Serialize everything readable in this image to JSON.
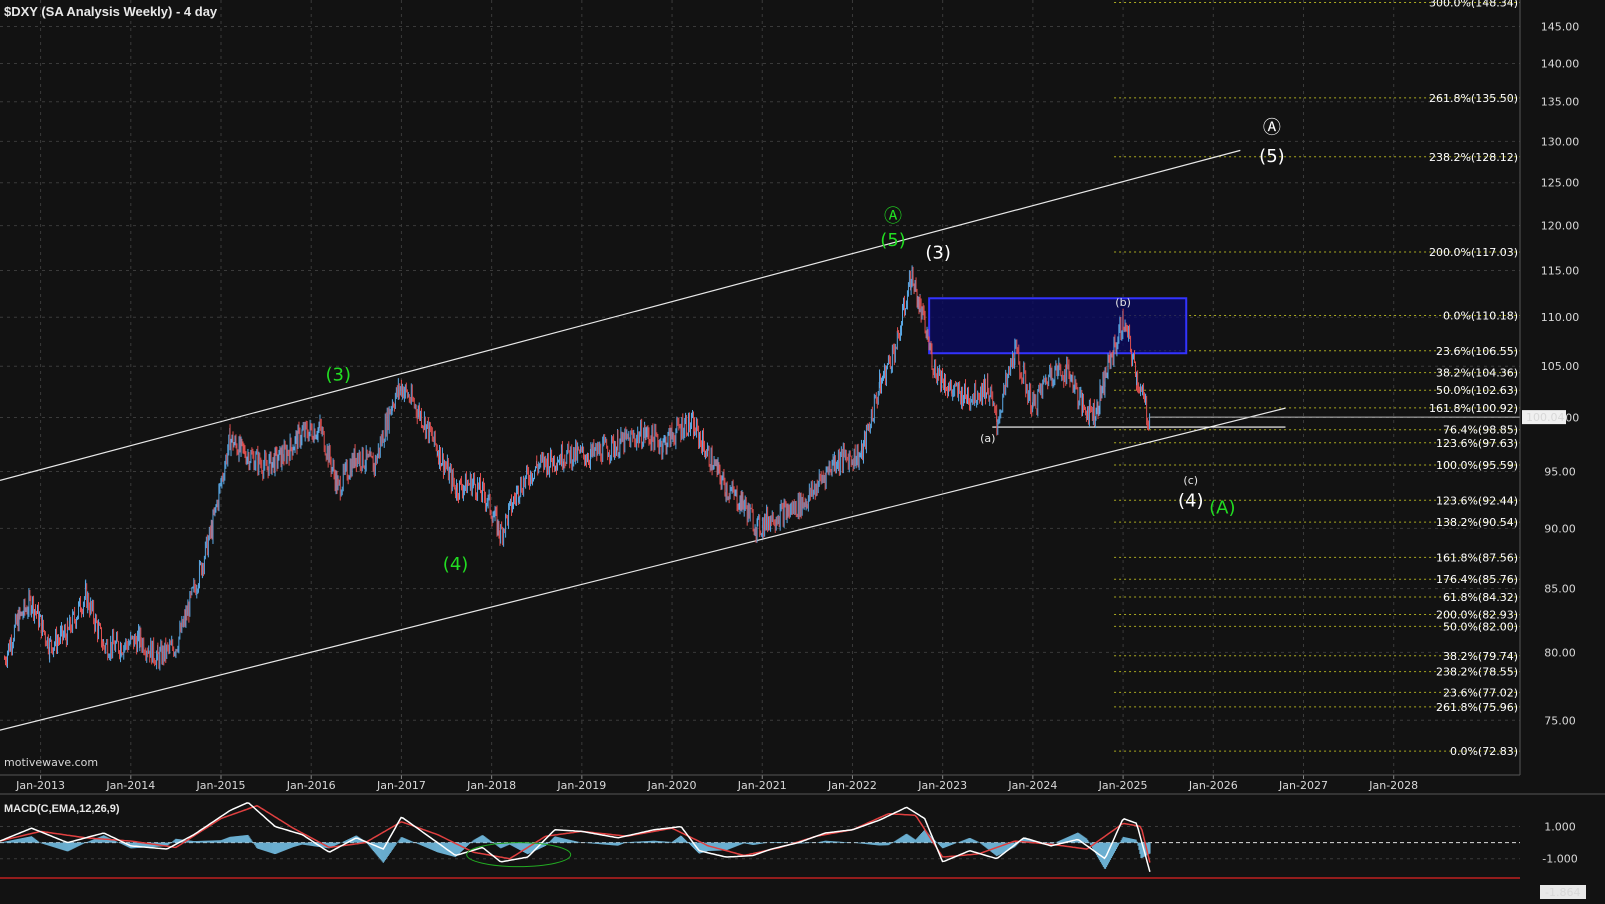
{
  "title": "$DXY (SA Analysis Weekly) - 4 day",
  "watermark": "motivewave.com",
  "colors": {
    "background": "#121212",
    "up_candle": "#5aa9e6",
    "down_candle": "#e05050",
    "fib_line": "#a8a820",
    "grid": "#3a3a3a",
    "green_label": "#22dd22",
    "white_label": "#ffffff",
    "box_fill": "#0a0a60",
    "box_stroke": "#3333ff",
    "macd_line": "#ffffff",
    "signal_line": "#e04040",
    "histogram": "#6aaed0"
  },
  "chart_data": [
    {
      "type": "line",
      "subtype": "candlestick",
      "title": "$DXY (SA Analysis Weekly) - 4 day",
      "x_ticks": [
        "Jan-2013",
        "Jan-2014",
        "Jan-2015",
        "Jan-2016",
        "Jan-2017",
        "Jan-2018",
        "Jan-2019",
        "Jan-2020",
        "Jan-2021",
        "Jan-2022",
        "Jan-2023",
        "Jan-2024",
        "Jan-2025",
        "Jan-2026",
        "Jan-2027",
        "Jan-2028"
      ],
      "x_tick_values": [
        2013,
        2014,
        2015,
        2016,
        2017,
        2018,
        2019,
        2020,
        2021,
        2022,
        2023,
        2024,
        2025,
        2026,
        2027,
        2028
      ],
      "xlim": [
        2012.55,
        2029.4
      ],
      "y_ticks": [
        "145.00",
        "140.00",
        "135.00",
        "130.00",
        "125.00",
        "120.00",
        "115.00",
        "110.00",
        "105.00",
        "100.00",
        "95.00",
        "90.00",
        "85.00",
        "80.00",
        "75.00"
      ],
      "y_tick_values": [
        145,
        140,
        135,
        130,
        125,
        120,
        115,
        110,
        105,
        100,
        95,
        90,
        85,
        80,
        75
      ],
      "ylim": [
        71.2,
        148.7
      ],
      "y_scale": "log",
      "grid": true,
      "last_price_label": "100.04",
      "last_price": 100.04,
      "series": [
        {
          "x": [
            2012.6,
            2012.75,
            2012.9,
            2013.1,
            2013.3,
            2013.5,
            2013.7,
            2013.9,
            2014.1,
            2014.3,
            2014.5,
            2014.6,
            2014.75,
            2014.9,
            2015.1,
            2015.2,
            2015.5,
            2015.7,
            2015.9,
            2016.1,
            2016.3,
            2016.5,
            2016.7,
            2016.9,
            2017.0,
            2017.2,
            2017.4,
            2017.6,
            2017.8,
            2017.95,
            2018.1,
            2018.3,
            2018.5,
            2018.8,
            2019.1,
            2019.4,
            2019.7,
            2019.9,
            2020.15,
            2020.25,
            2020.4,
            2020.6,
            2020.8,
            2020.95,
            2021.1,
            2021.3,
            2021.5,
            2021.8,
            2022.1,
            2022.3,
            2022.5,
            2022.65,
            2022.75,
            2022.9,
            2023.1,
            2023.3,
            2023.5,
            2023.6,
            2023.8,
            2024.0,
            2024.2,
            2024.4,
            2024.55,
            2024.7,
            2024.8,
            2025.0,
            2025.05,
            2025.15,
            2025.25,
            2025.3
          ],
          "y": [
            79.5,
            82.5,
            84.0,
            80.5,
            81.5,
            84.5,
            80.5,
            80.5,
            81.0,
            79.6,
            80.5,
            82.5,
            86.0,
            90.0,
            98.0,
            97.0,
            95.5,
            96.5,
            98.5,
            99.0,
            93.5,
            96.5,
            95.5,
            101.5,
            103.0,
            100.5,
            97.0,
            93.5,
            94.0,
            92.5,
            89.5,
            93.5,
            95.5,
            96.5,
            96.5,
            97.5,
            98.5,
            97.5,
            99.5,
            99.0,
            96.5,
            93.5,
            92.0,
            90.0,
            91.0,
            91.5,
            92.5,
            96.0,
            96.5,
            103.0,
            107.5,
            114.5,
            111.0,
            105.0,
            102.5,
            102.0,
            103.0,
            99.5,
            106.5,
            101.0,
            104.5,
            104.5,
            101.0,
            100.5,
            104.0,
            109.5,
            108.0,
            104.0,
            101.0,
            99.1
          ]
        }
      ],
      "fib_levels": [
        {
          "label": "300.0%(148.34)",
          "value": 148.34
        },
        {
          "label": "261.8%(135.50)",
          "value": 135.5
        },
        {
          "label": "238.2%(128.12)",
          "value": 128.12
        },
        {
          "label": "200.0%(117.03)",
          "value": 117.03
        },
        {
          "label": "0.0%(110.18)",
          "value": 110.18
        },
        {
          "label": "23.6%(106.55)",
          "value": 106.55
        },
        {
          "label": "38.2%(104.36)",
          "value": 104.36
        },
        {
          "label": "50.0%(102.63)",
          "value": 102.63
        },
        {
          "label": "161.8%(100.92)",
          "value": 100.92
        },
        {
          "label": "76.4%(98.85)",
          "value": 98.85
        },
        {
          "label": "123.6%(97.63)",
          "value": 97.63
        },
        {
          "label": "100.0%(95.59)",
          "value": 95.59
        },
        {
          "label": "123.6%(92.44)",
          "value": 92.44
        },
        {
          "label": "138.2%(90.54)",
          "value": 90.54
        },
        {
          "label": "161.8%(87.56)",
          "value": 87.56
        },
        {
          "label": "176.4%(85.76)",
          "value": 85.76
        },
        {
          "label": "61.8%(84.32)",
          "value": 84.32
        },
        {
          "label": "200.0%(82.93)",
          "value": 82.93
        },
        {
          "label": "50.0%(82.00)",
          "value": 82.0
        },
        {
          "label": "38.2%(79.74)",
          "value": 79.74
        },
        {
          "label": "238.2%(78.55)",
          "value": 78.55
        },
        {
          "label": "23.6%(77.02)",
          "value": 77.02
        },
        {
          "label": "261.8%(75.96)",
          "value": 75.96
        },
        {
          "label": "0.0%(72.83)",
          "value": 72.83
        }
      ],
      "channel_lines": [
        {
          "x": [
            2012.55,
            2026.3
          ],
          "y": [
            94.2,
            128.9
          ]
        },
        {
          "x": [
            2012.55,
            2026.8
          ],
          "y": [
            74.3,
            100.9
          ]
        }
      ],
      "target_box": {
        "x": [
          2022.85,
          2025.7
        ],
        "y": [
          106.3,
          112.0
        ]
      },
      "support_line": {
        "x": [
          2023.55,
          2026.8
        ],
        "y": 99.1
      },
      "wave_labels": [
        {
          "text": "Ⓐ",
          "x": 2022.45,
          "y": 120.4,
          "color": "green"
        },
        {
          "text": "(5)",
          "x": 2022.45,
          "y": 117.7,
          "color": "green"
        },
        {
          "text": "(3)",
          "x": 2022.95,
          "y": 116.3,
          "color": "white"
        },
        {
          "text": "(3)",
          "x": 2016.3,
          "y": 103.6,
          "color": "green"
        },
        {
          "text": "(4)",
          "x": 2017.6,
          "y": 86.5,
          "color": "green"
        },
        {
          "text": "Ⓐ",
          "x": 2026.65,
          "y": 131.0,
          "color": "white"
        },
        {
          "text": "(5)",
          "x": 2026.65,
          "y": 127.5,
          "color": "white"
        },
        {
          "text": "(a)",
          "x": 2023.5,
          "y": 97.7,
          "color": "white",
          "small": true
        },
        {
          "text": "(b)",
          "x": 2025.0,
          "y": 111.2,
          "color": "white",
          "small": true
        },
        {
          "text": "(c)",
          "x": 2025.75,
          "y": 93.9,
          "color": "white",
          "small": true
        },
        {
          "text": "(4)",
          "x": 2025.75,
          "y": 91.9,
          "color": "white"
        },
        {
          "text": "(A)",
          "x": 2026.1,
          "y": 91.3,
          "color": "green"
        }
      ]
    },
    {
      "type": "line",
      "title": "MACD(C,EMA,12,26,9)",
      "ylim": [
        -2.2,
        2.9
      ],
      "y_ticks": [
        "1.000",
        "-1.000"
      ],
      "y_tick_values": [
        1.0,
        -1.0
      ],
      "last_value_label": "-1.864",
      "series": [
        {
          "name": "MACD",
          "x": [
            2012.55,
            2012.9,
            2013.3,
            2013.7,
            2014.0,
            2014.4,
            2014.7,
            2015.1,
            2015.3,
            2015.6,
            2015.9,
            2016.2,
            2016.5,
            2016.8,
            2017.0,
            2017.3,
            2017.6,
            2017.9,
            2018.1,
            2018.4,
            2018.7,
            2019.0,
            2019.4,
            2019.8,
            2020.1,
            2020.3,
            2020.6,
            2020.9,
            2021.1,
            2021.4,
            2021.7,
            2022.0,
            2022.3,
            2022.6,
            2022.8,
            2023.0,
            2023.3,
            2023.6,
            2023.9,
            2024.2,
            2024.5,
            2024.8,
            2025.0,
            2025.15,
            2025.3
          ],
          "y": [
            0.1,
            0.9,
            0.0,
            0.6,
            -0.2,
            -0.4,
            0.5,
            2.0,
            2.5,
            1.0,
            0.5,
            -0.6,
            0.3,
            -0.4,
            1.6,
            0.4,
            -0.8,
            -0.3,
            -1.2,
            -0.9,
            0.8,
            0.7,
            0.3,
            0.8,
            1.0,
            -0.5,
            -0.9,
            -0.8,
            -0.4,
            0.0,
            0.6,
            0.8,
            1.4,
            2.2,
            1.5,
            -1.2,
            -0.5,
            -1.0,
            0.3,
            -0.2,
            0.2,
            -1.0,
            1.5,
            1.2,
            -1.864
          ]
        },
        {
          "name": "Signal",
          "x": [
            2012.55,
            2013.0,
            2013.5,
            2014.0,
            2014.5,
            2015.0,
            2015.4,
            2015.8,
            2016.2,
            2016.6,
            2017.0,
            2017.4,
            2017.8,
            2018.2,
            2018.6,
            2019.0,
            2019.5,
            2020.0,
            2020.4,
            2020.8,
            2021.2,
            2021.6,
            2022.0,
            2022.4,
            2022.7,
            2023.0,
            2023.4,
            2023.8,
            2024.2,
            2024.6,
            2025.0,
            2025.2,
            2025.3
          ],
          "y": [
            0.1,
            0.7,
            0.3,
            0.1,
            -0.3,
            1.5,
            2.3,
            0.9,
            -0.3,
            0.0,
            1.3,
            0.5,
            -0.6,
            -1.0,
            0.4,
            0.7,
            0.4,
            0.9,
            -0.2,
            -0.8,
            -0.3,
            0.4,
            0.8,
            1.8,
            1.7,
            -0.9,
            -0.7,
            0.1,
            -0.1,
            -0.4,
            1.2,
            1.0,
            -1.3
          ]
        }
      ]
    }
  ]
}
